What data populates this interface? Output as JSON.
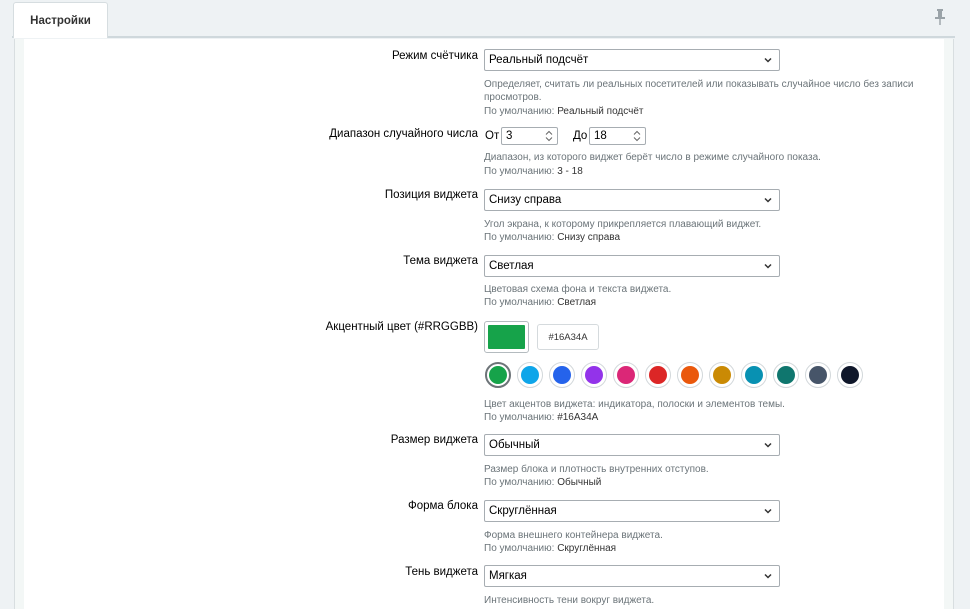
{
  "tab": {
    "label": "Настройки"
  },
  "settings": {
    "counter_mode": {
      "label": "Режим счётчика",
      "value": "Реальный подсчёт",
      "help": "Определяет, считать ли реальных посетителей или показывать случайное число без записи просмотров.",
      "default_prefix": "По умолчанию:",
      "default_value": "Реальный подсчёт"
    },
    "random_range": {
      "label": "Диапазон случайного числа",
      "from_label": "От",
      "from_value": "3",
      "to_label": "До",
      "to_value": "18",
      "help": "Диапазон, из которого виджет берёт число в режиме случайного показа.",
      "default_prefix": "По умолчанию:",
      "default_value": "3 - 18"
    },
    "position": {
      "label": "Позиция виджета",
      "value": "Снизу справа",
      "help": "Угол экрана, к которому прикрепляется плавающий виджет.",
      "default_prefix": "По умолчанию:",
      "default_value": "Снизу справа"
    },
    "theme": {
      "label": "Тема виджета",
      "value": "Светлая",
      "help": "Цветовая схема фона и текста виджета.",
      "default_prefix": "По умолчанию:",
      "default_value": "Светлая"
    },
    "accent": {
      "label": "Акцентный цвет (#RRGGBB)",
      "hex": "#16A34A",
      "palette": [
        "#16a34a",
        "#0ea5e9",
        "#2563eb",
        "#9333ea",
        "#db2777",
        "#dc2626",
        "#ea580c",
        "#ca8a04",
        "#0891b2",
        "#0f766e",
        "#475569",
        "#0f172a"
      ],
      "help": "Цвет акцентов виджета: индикатора, полоски и элементов темы.",
      "default_prefix": "По умолчанию:",
      "default_value": "#16A34A"
    },
    "size": {
      "label": "Размер виджета",
      "value": "Обычный",
      "help": "Размер блока и плотность внутренних отступов.",
      "default_prefix": "По умолчанию:",
      "default_value": "Обычный"
    },
    "shape": {
      "label": "Форма блока",
      "value": "Скруглённая",
      "help": "Форма внешнего контейнера виджета.",
      "default_prefix": "По умолчанию:",
      "default_value": "Скруглённая"
    },
    "shadow": {
      "label": "Тень виджета",
      "value": "Мягкая",
      "help": "Интенсивность тени вокруг виджета."
    }
  }
}
